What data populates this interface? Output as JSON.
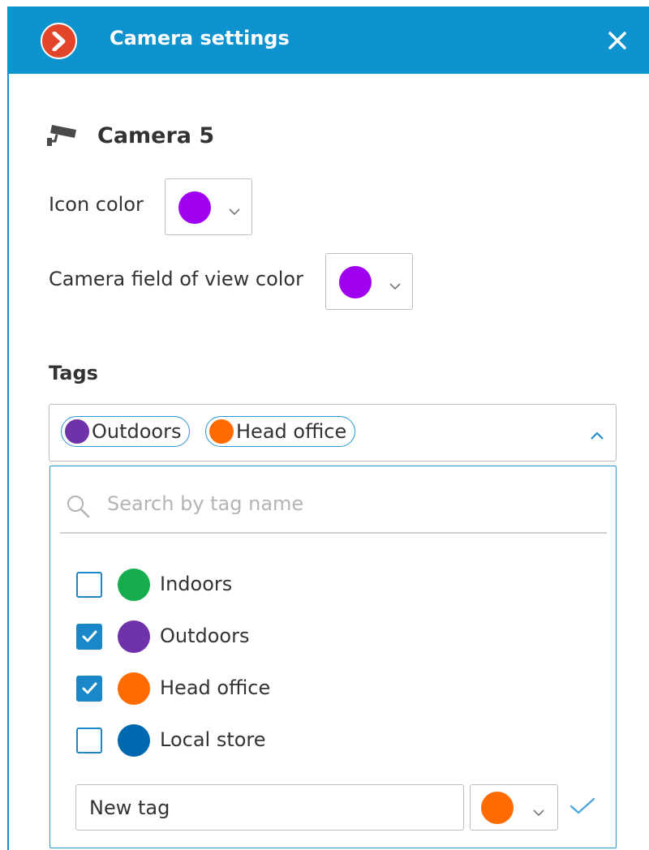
{
  "header": {
    "title": "Camera settings",
    "logo_icon": "chevron-right-logo",
    "close_icon": "close-icon",
    "bg_color": "#0f93cf"
  },
  "camera": {
    "name": "Camera 5",
    "icon": "camera-icon"
  },
  "icon_color": {
    "label": "Icon color",
    "value_color": "#a000f0"
  },
  "fov_color": {
    "label": "Camera field of view color",
    "value_color": "#a000f0"
  },
  "tags": {
    "label": "Tags",
    "selected": [
      {
        "label": "Outdoors",
        "color": "#6f32a8"
      },
      {
        "label": "Head office",
        "color": "#ff6b00"
      }
    ],
    "search_placeholder": "Search by tag name",
    "options": [
      {
        "label": "Indoors",
        "color": "#16ad4f",
        "checked": false
      },
      {
        "label": "Outdoors",
        "color": "#6f32a8",
        "checked": true
      },
      {
        "label": "Head office",
        "color": "#ff6b00",
        "checked": true
      },
      {
        "label": "Local store",
        "color": "#0068ae",
        "checked": false
      }
    ],
    "new_tag": {
      "value": "New tag",
      "color": "#ff6b00"
    }
  },
  "accent_color": "#1a87c9"
}
